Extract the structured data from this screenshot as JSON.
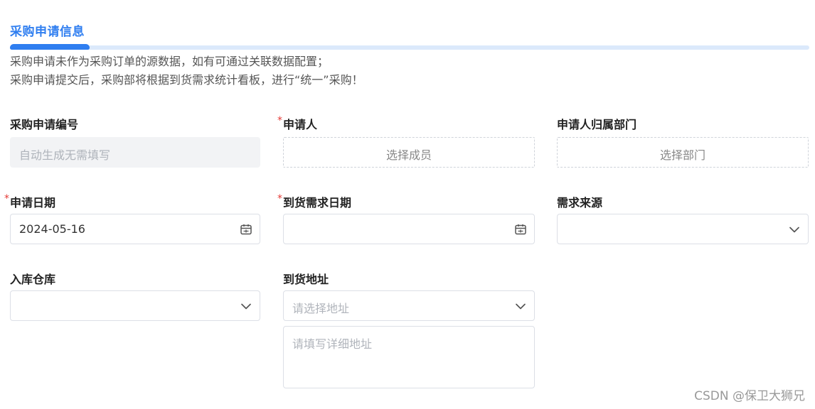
{
  "section": {
    "title": "采购申请信息",
    "desc_line1": "采购申请未作为采购订单的源数据，如有可通过关联数据配置；",
    "desc_line2": "采购申请提交后，采购部将根据到货需求统计看板，进行“统一”采购！"
  },
  "fields": {
    "request_no": {
      "label": "采购申请编号",
      "placeholder": "自动生成无需填写"
    },
    "applicant": {
      "label": "申请人",
      "required_mark": "*",
      "button": "选择成员"
    },
    "department": {
      "label": "申请人归属部门",
      "button": "选择部门"
    },
    "apply_date": {
      "label": "申请日期",
      "required_mark": "*",
      "value": "2024-05-16"
    },
    "arrival_date": {
      "label": "到货需求日期",
      "required_mark": "*",
      "value": ""
    },
    "demand_source": {
      "label": "需求来源",
      "value": ""
    },
    "warehouse": {
      "label": "入库仓库",
      "value": ""
    },
    "address": {
      "label": "到货地址",
      "placeholder": "请选择地址",
      "detail_placeholder": "请填写详细地址"
    }
  },
  "icons": {
    "calendar": "calendar-icon",
    "chevron": "chevron-down-icon"
  },
  "colors": {
    "accent": "#2f7ef0",
    "required": "#e53935"
  },
  "watermark": "CSDN @保卫大狮兄"
}
